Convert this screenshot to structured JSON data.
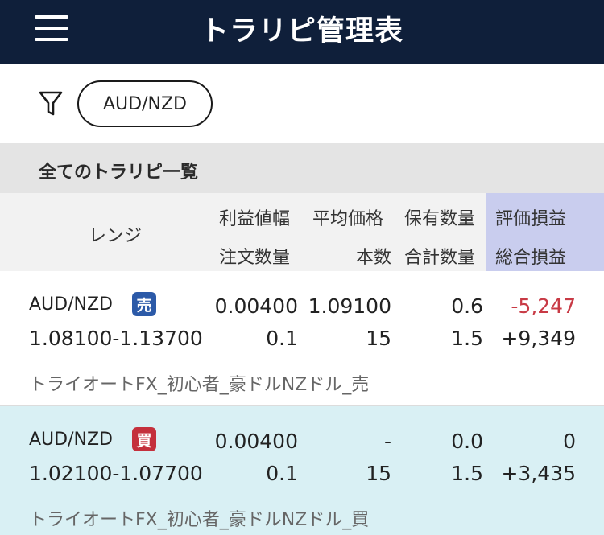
{
  "header": {
    "title": "トラリピ管理表"
  },
  "filter": {
    "selected_pair": "AUD/NZD"
  },
  "section": {
    "title": "全てのトラリピ一覧"
  },
  "columns": {
    "range": "レンジ",
    "profit_width": "利益値幅",
    "order_qty": "注文数量",
    "avg_price": "平均価格",
    "count": "本数",
    "holding_qty": "保有数量",
    "total_qty": "合計数量",
    "eval_pl": "評価損益",
    "total_pl": "総合損益"
  },
  "colors": {
    "header_bg": "#0f1f3a",
    "sell_badge": "#2c5aa8",
    "buy_badge": "#c4303c",
    "negative": "#c83a45",
    "eval_column_bg": "#c9cdee",
    "buy_row_bg": "#d9f0f4"
  },
  "rows": [
    {
      "pair": "AUD/NZD",
      "side": "売",
      "range": "1.08100-1.13700",
      "profit_width": "0.00400",
      "order_qty": "0.1",
      "avg_price": "1.09100",
      "count": "15",
      "holding_qty": "0.6",
      "total_qty": "1.5",
      "eval_pl": "-5,247",
      "total_pl": "+9,349",
      "strategy": "トライオートFX_初心者_豪ドルNZドル_売"
    },
    {
      "pair": "AUD/NZD",
      "side": "買",
      "range": "1.02100-1.07700",
      "profit_width": "0.00400",
      "order_qty": "0.1",
      "avg_price": "-",
      "count": "15",
      "holding_qty": "0.0",
      "total_qty": "1.5",
      "eval_pl": "0",
      "total_pl": "+3,435",
      "strategy": "トライオートFX_初心者_豪ドルNZドル_買"
    }
  ]
}
